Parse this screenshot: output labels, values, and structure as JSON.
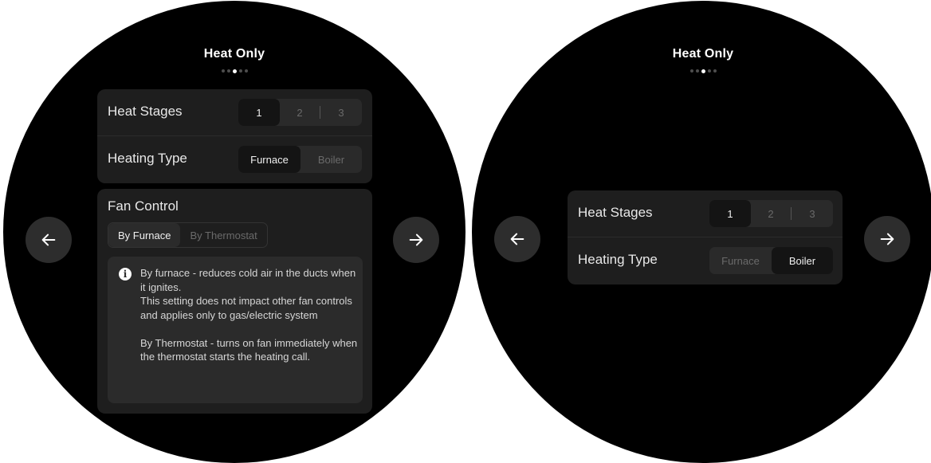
{
  "left_screen": {
    "title": "Heat Only",
    "page_indicator": {
      "count": 5,
      "active": 3
    },
    "heat_stages": {
      "label": "Heat Stages",
      "options": [
        "1",
        "2",
        "3"
      ],
      "selected": "1"
    },
    "heating_type": {
      "label": "Heating Type",
      "options": [
        "Furnace",
        "Boiler"
      ],
      "selected": "Furnace"
    },
    "fan_control": {
      "label": "Fan Control",
      "options": [
        "By Furnace",
        "By Thermostat"
      ],
      "selected": "By Furnace",
      "info": {
        "icon": "info-icon",
        "line1": "By furnace - reduces cold air in the ducts when it ignites.",
        "line2": "This setting does not impact other fan controls and applies only to gas/electric system",
        "line3": "By Thermostat  - turns on fan immediately when the thermostat starts the heating call."
      }
    },
    "nav": {
      "back_icon": "arrow-left-icon",
      "forward_icon": "arrow-right-icon"
    }
  },
  "right_screen": {
    "title": "Heat Only",
    "page_indicator": {
      "count": 5,
      "active": 3
    },
    "heat_stages": {
      "label": "Heat Stages",
      "options": [
        "1",
        "2",
        "3"
      ],
      "selected": "1"
    },
    "heating_type": {
      "label": "Heating Type",
      "options": [
        "Furnace",
        "Boiler"
      ],
      "selected": "Boiler"
    },
    "nav": {
      "back_icon": "arrow-left-icon",
      "forward_icon": "arrow-right-icon"
    }
  },
  "colors": {
    "screen_bg": "#000000",
    "card_bg": "#1e1e1e",
    "segment_bg": "#2a2a2a",
    "selected_bg": "#141414",
    "nav_button_bg": "#2d2d2d",
    "text_primary": "#ffffff",
    "text_muted": "#6a6a6a"
  }
}
